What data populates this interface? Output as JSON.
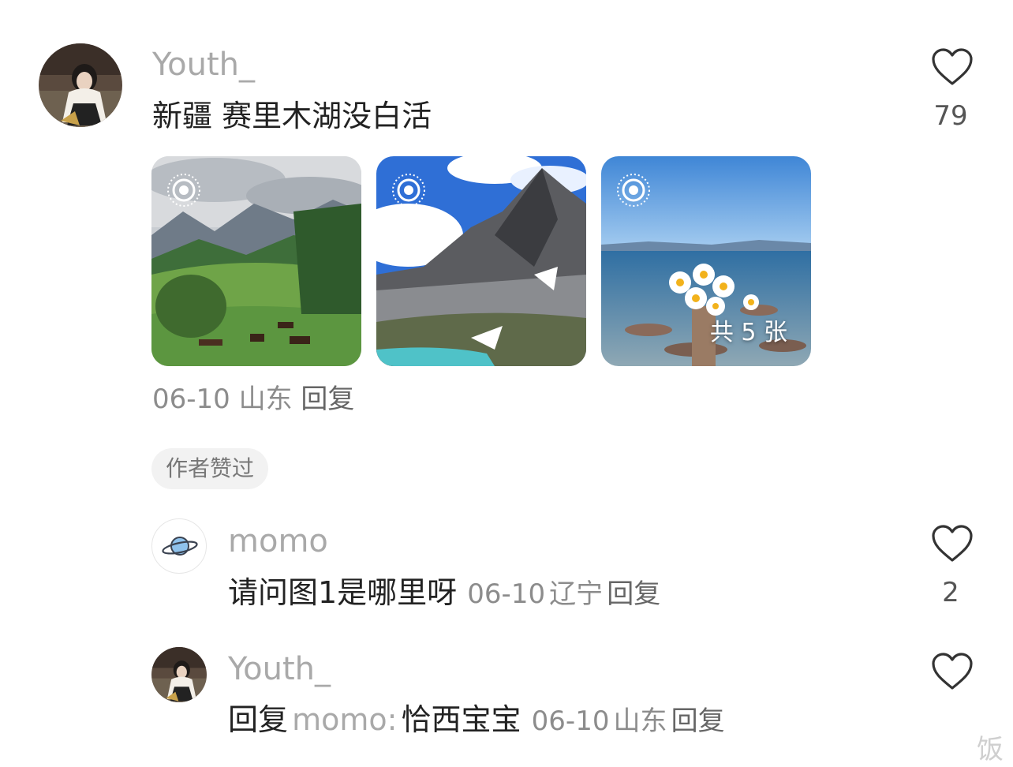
{
  "comment": {
    "username": "Youth_",
    "text": "新疆 赛里木湖没白活",
    "like_count": "79",
    "date": "06-10",
    "location": "山东",
    "reply_label": "回复",
    "images_total_label": "共 5 张",
    "author_liked_badge": "作者赞过"
  },
  "replies": [
    {
      "username": "momo",
      "text": "请问图1是哪里呀",
      "date": "06-10",
      "location": "辽宁",
      "reply_label": "回复",
      "like_count": "2"
    },
    {
      "username": "Youth_",
      "reply_prefix": "回复",
      "reply_to": "momo:",
      "text": "恰西宝宝",
      "date": "06-10",
      "location": "山东",
      "reply_label": "回复"
    }
  ],
  "watermark": "饭",
  "icons": {
    "like": "heart-outline-icon",
    "live_photo": "live-photo-icon",
    "planet_avatar": "planet-icon"
  }
}
